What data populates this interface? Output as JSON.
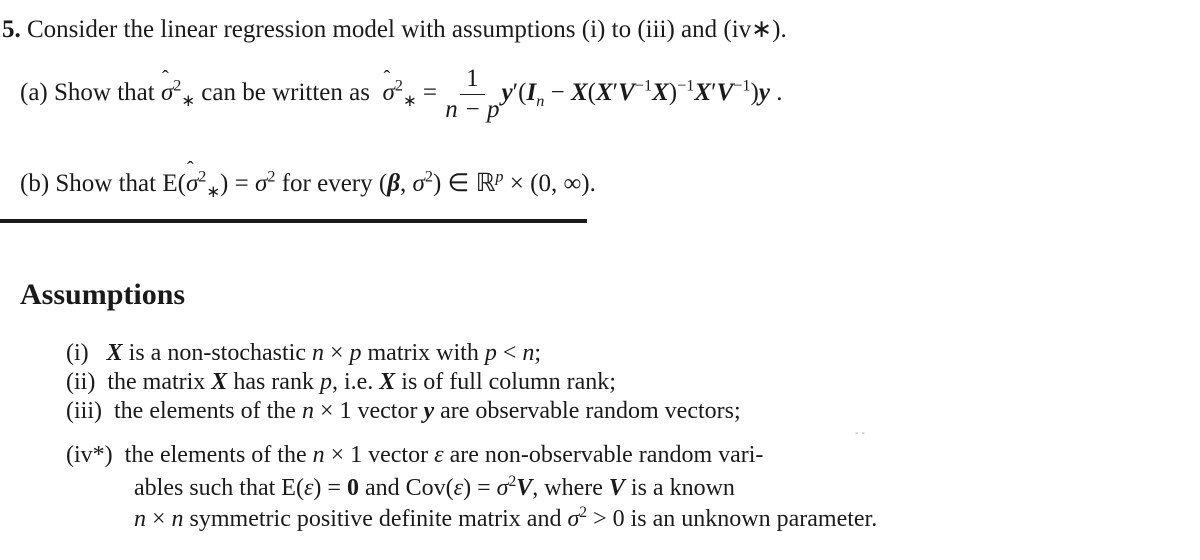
{
  "problem": {
    "number": "5.",
    "intro": "Consider the linear regression model with assumptions (i) to (iii) and (iv*).",
    "part_a": {
      "label": "(a)",
      "text": "Show that σ̂²* can be written as",
      "formula_lhs": "σ̂²* =",
      "frac_num": "1",
      "frac_den": "n − p",
      "formula_rhs": "y′(Iₙ − X(X′V⁻¹X)⁻¹X′V⁻¹)y ."
    },
    "part_b": {
      "label": "(b)",
      "text": "Show that E(σ̂²*) = σ² for every (β, σ²) ∈ ℝᵖ × (0, ∞)."
    }
  },
  "assumptions": {
    "heading": "Assumptions",
    "items": [
      {
        "label": "(i)",
        "text": "X is a non-stochastic n × p matrix with p < n;"
      },
      {
        "label": "(ii)",
        "text": "the matrix X has rank p, i.e. X is of full column rank;"
      },
      {
        "label": "(iii)",
        "text": "the elements of the n × 1 vector y are observable random vectors;"
      },
      {
        "label": "(iv*)",
        "text": "the elements of the n × 1 vector ε are non-observable random variables such that E(ε) = 0 and Cov(ε) = σ²V, where V is a known n × n symmetric positive definite matrix and σ² > 0 is an unknown parameter.",
        "lines": [
          "the elements of the n × 1 vector ε are non-observable random vari-",
          "ables such that E(ε) = 0 and Cov(ε) = σ²V, where V is a known",
          "n × n symmetric positive definite matrix and σ² > 0 is an unknown parameter."
        ]
      }
    ]
  }
}
